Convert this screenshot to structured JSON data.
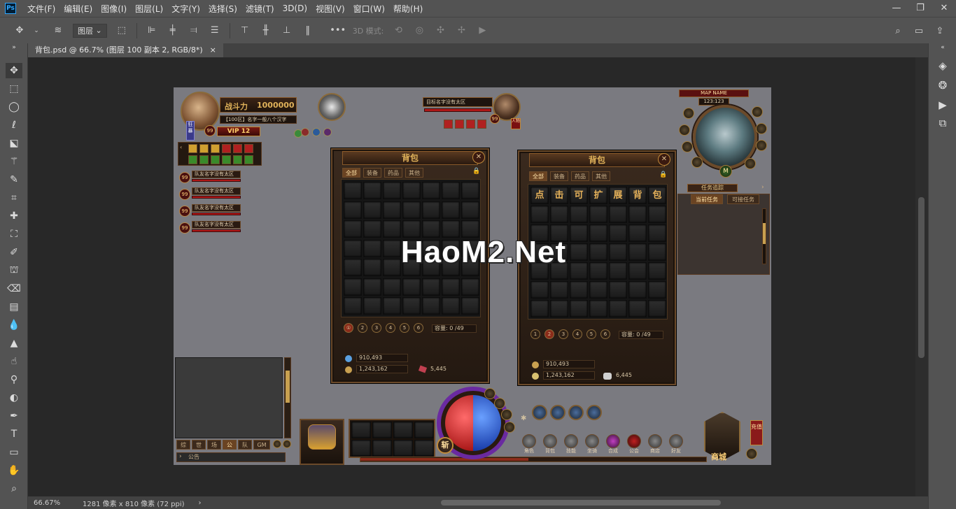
{
  "app": {
    "logo": "Ps"
  },
  "menu": [
    "文件(F)",
    "编辑(E)",
    "图像(I)",
    "图层(L)",
    "文字(Y)",
    "选择(S)",
    "滤镜(T)",
    "3D(D)",
    "视图(V)",
    "窗口(W)",
    "帮助(H)"
  ],
  "window_controls": {
    "minimize": "—",
    "restore": "❐",
    "close": "✕"
  },
  "options": {
    "auto_select": "图层",
    "mode3d": "3D 模式:"
  },
  "document_tab": {
    "title": "背包.psd @ 66.7% (图层 100 副本 2, RGB/8*)",
    "close": "×"
  },
  "status": {
    "zoom": "66.67%",
    "info": "1281 像素 x 810 像素 (72 ppi)"
  },
  "game": {
    "watermark": "HaoM2.Net",
    "player": {
      "power_label": "战斗力",
      "power_value": "1000000",
      "name": "【100区】名字一般八个汉字",
      "level": "99",
      "vip": "VIP 12",
      "side_tag": "狂暴"
    },
    "target": {
      "name": "目标名字没有太区",
      "level": "99",
      "tag": "人物"
    },
    "team": [
      {
        "level": "99",
        "name": "队友名字没有太区"
      },
      {
        "level": "99",
        "name": "队友名字没有太区"
      },
      {
        "level": "99",
        "name": "队友名字没有太区"
      },
      {
        "level": "99",
        "name": "队友名字没有太区"
      }
    ],
    "minimap": {
      "title": "MAP NAME",
      "coords": "123:123",
      "center_btn": "M"
    },
    "quest": {
      "title": "任务追踪",
      "tab_current": "当前任务",
      "tab_available": "可接任务"
    },
    "bag1": {
      "title": "背包",
      "tabs": [
        "全部",
        "装备",
        "药品",
        "其他"
      ],
      "pages": [
        "①",
        "2",
        "3",
        "4",
        "5",
        "6"
      ],
      "capacity": "容量: 0 /49",
      "gold": "910,493",
      "silver": "1,243,162",
      "gem": "5,445"
    },
    "bag2": {
      "title": "背包",
      "tabs": [
        "全部",
        "装备",
        "药品",
        "其他"
      ],
      "header_chars": [
        "点",
        "击",
        "可",
        "扩",
        "展",
        "背",
        "包"
      ],
      "pages": [
        "1",
        "2",
        "3",
        "4",
        "5",
        "6"
      ],
      "capacity": "容量: 0 /49",
      "gold": "910,493",
      "silver": "1,243,162",
      "gem": "6,445"
    },
    "chat": {
      "tabs": [
        "综",
        "世",
        "场",
        "公",
        "队",
        "GM"
      ],
      "input_placeholder": "公告"
    },
    "bottom": {
      "kill_btn": "斩",
      "shop": "商城",
      "side_btn": "充值",
      "menu": [
        "角色",
        "背包",
        "技能",
        "坐骑",
        "合成",
        "公会",
        "商店",
        "好友"
      ]
    }
  }
}
